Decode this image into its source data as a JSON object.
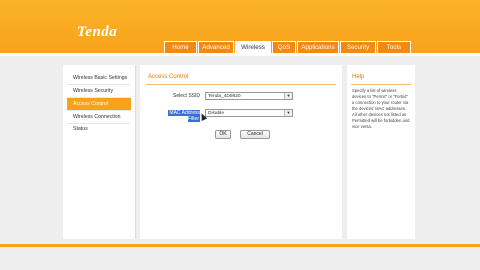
{
  "brand": {
    "logo": "Tenda"
  },
  "tabs": [
    {
      "label": "Home"
    },
    {
      "label": "Advanced"
    },
    {
      "label": "Wireless"
    },
    {
      "label": "QoS"
    },
    {
      "label": "Applications"
    },
    {
      "label": "Security"
    },
    {
      "label": "Tools"
    }
  ],
  "sidebar": {
    "items": [
      {
        "label": "Wireless Basic Settings"
      },
      {
        "label": "Wireless Security"
      },
      {
        "label": "Access Control"
      },
      {
        "label": "Wireless Connection Status"
      }
    ]
  },
  "main": {
    "title": "Access Control",
    "ssid": {
      "label": "Select SSID",
      "value": "Tenda_4D9820"
    },
    "mac_filter": {
      "label": "MAC Address Filter",
      "value": "Disable"
    },
    "ok_label": "OK",
    "cancel_label": "Cancel"
  },
  "help": {
    "title": "Help",
    "text": "Specify a list of wireless devices to \"Permit\" or \"Forbid\" a connection to your router via the devices' MAC addresses. All other devices not listed as Permitted will be forbidden and vice versa."
  },
  "colors": {
    "accent": "#f7a21a",
    "tab_bg": "#f08a11",
    "selection": "#3b6fd6"
  }
}
